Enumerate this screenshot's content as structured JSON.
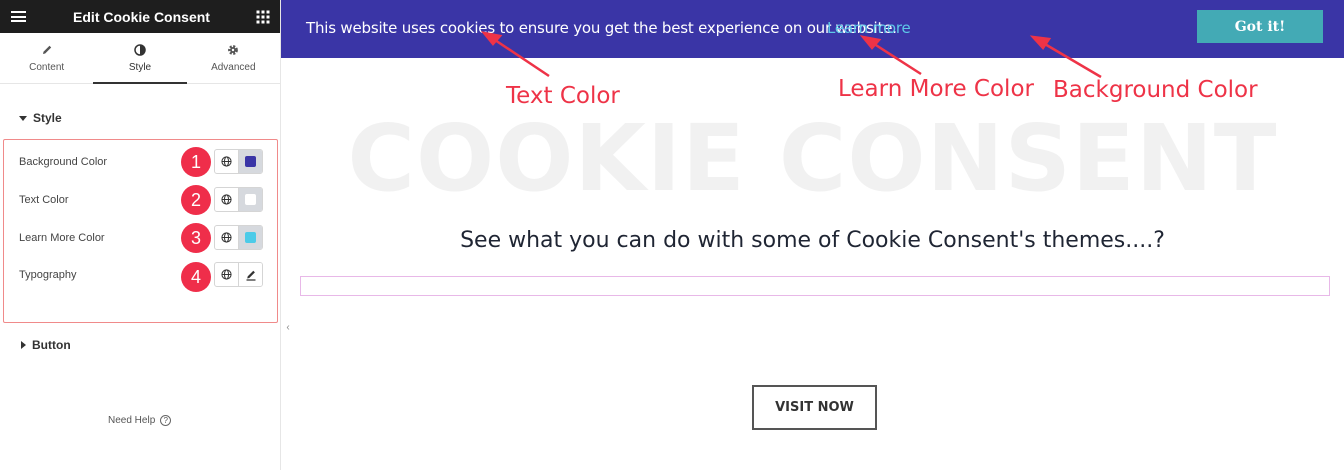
{
  "panel": {
    "title": "Edit Cookie Consent",
    "tabs": [
      {
        "label": "Content",
        "icon": "pencil-icon"
      },
      {
        "label": "Style",
        "icon": "half-circle-icon"
      },
      {
        "label": "Advanced",
        "icon": "gear-icon"
      }
    ],
    "active_tab": "Style",
    "style_section": {
      "title": "Style",
      "controls": [
        {
          "label": "Background Color",
          "badge": "1",
          "kind": "color",
          "swatch": "#3a35a6"
        },
        {
          "label": "Text Color",
          "badge": "2",
          "kind": "color",
          "swatch": "#ffffff"
        },
        {
          "label": "Learn More Color",
          "badge": "3",
          "kind": "color",
          "swatch": "#4ccbe8"
        },
        {
          "label": "Typography",
          "badge": "4",
          "kind": "edit"
        }
      ]
    },
    "button_section": {
      "title": "Button"
    },
    "need_help": "Need Help"
  },
  "preview": {
    "banner": {
      "text": "This website uses cookies to ensure you get the best experience on our website.",
      "learn_more": "Learn more",
      "button": "Got it!",
      "background": "#3a35a6",
      "link_color": "#5ec8e8",
      "button_color": "#43aab5"
    },
    "annotations": {
      "text_color": "Text Color",
      "learn_more_color": "Learn More Color",
      "background_color": "Background Color"
    },
    "watermark": "COOKIE CONSENT",
    "subheading": "See what you can do with some of Cookie Consent's themes....?",
    "visit_button": "VISIT NOW"
  },
  "colors": {
    "annotation": "#ee3347",
    "badge": "#ef2e4a"
  }
}
